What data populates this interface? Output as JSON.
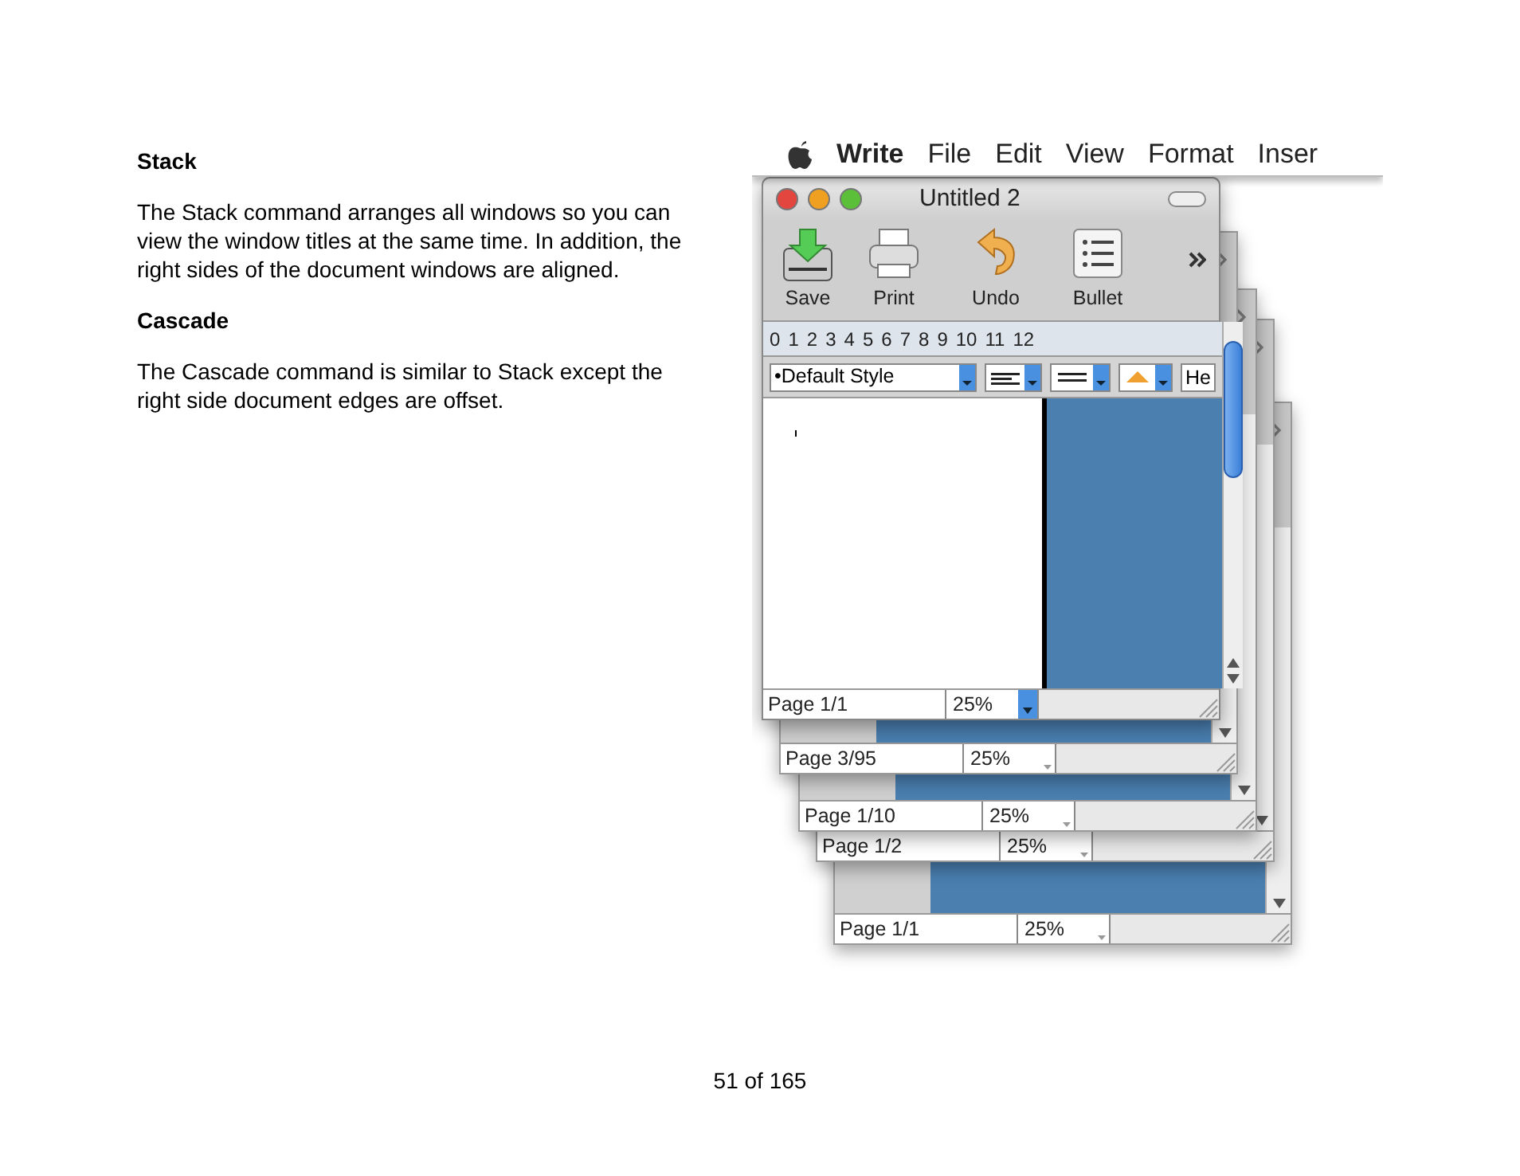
{
  "document": {
    "sections": [
      {
        "heading": "Stack",
        "text": "The Stack command arranges all windows so you can view the window titles at the same time. In addition, the right sides of the document windows are aligned."
      },
      {
        "heading": "Cascade",
        "text": "The Cascade command is similar to Stack except the right side document edges are offset."
      }
    ],
    "page_number": "51 of 165"
  },
  "screenshot": {
    "menu_bar": {
      "app": "Write",
      "items": [
        "File",
        "Edit",
        "View",
        "Format",
        "Inser"
      ]
    },
    "front_window": {
      "title": "Untitled 2",
      "toolbar": [
        {
          "kind": "save",
          "label": "Save"
        },
        {
          "kind": "print",
          "label": "Print"
        },
        {
          "kind": "undo",
          "label": "Undo"
        },
        {
          "kind": "bullet",
          "label": "Bullet"
        }
      ],
      "ruler": [
        "0",
        "1",
        "2",
        "3",
        "4",
        "5",
        "6",
        "7",
        "8",
        "9",
        "10",
        "11",
        "12"
      ],
      "style": "•Default Style",
      "font": "He",
      "page": "Page 1/1",
      "zoom": "25%"
    },
    "back_windows": [
      {
        "page": "Page 3/95",
        "zoom": "25%"
      },
      {
        "page": "Page 1/10",
        "zoom": "25%"
      },
      {
        "page": "Page 1/2",
        "zoom": "25%"
      },
      {
        "page": "Page 1/1",
        "zoom": "25%"
      }
    ]
  }
}
